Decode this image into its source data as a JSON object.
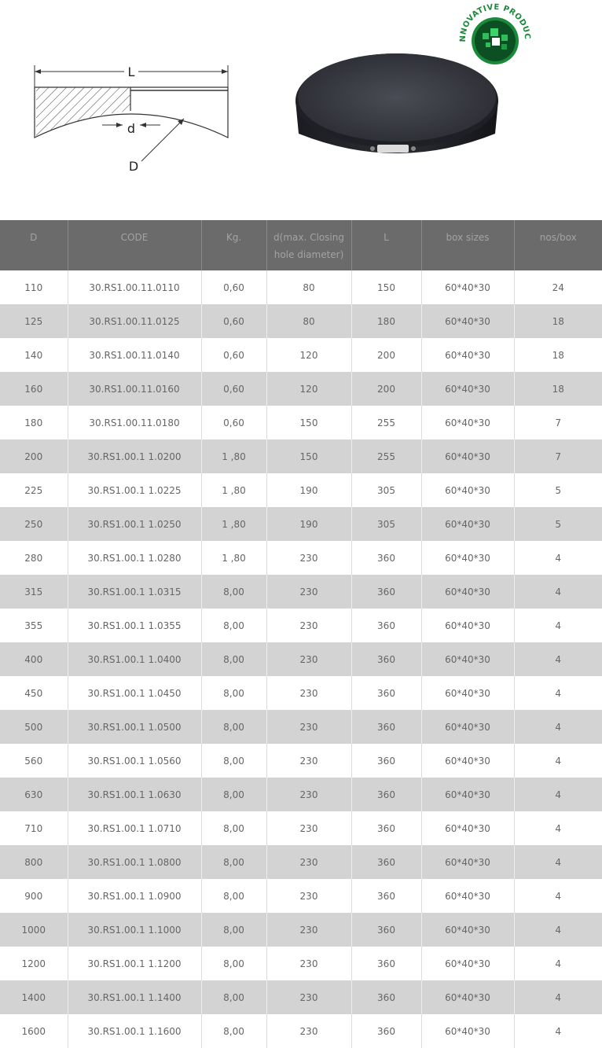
{
  "diagram": {
    "label_L": "L",
    "label_d": "d",
    "label_D": "D"
  },
  "badge": {
    "text": "INNOVATIVE PRODUCT",
    "colors": {
      "green": "#1a8a3a",
      "dark_green": "#0b4f22"
    }
  },
  "table": {
    "headers": [
      "D",
      "CODE",
      "Kg.",
      "d(max. Closing hole diameter)",
      "L",
      "box sizes",
      "nos/box"
    ],
    "rows": [
      [
        "110",
        "30.RS1.00.11.0110",
        "0,60",
        "80",
        "150",
        "60*40*30",
        "24"
      ],
      [
        "125",
        "30.RS1.00.11.0125",
        "0,60",
        "80",
        "180",
        "60*40*30",
        "18"
      ],
      [
        "140",
        "30.RS1.00.11.0140",
        "0,60",
        "120",
        "200",
        "60*40*30",
        "18"
      ],
      [
        "160",
        "30.RS1.00.11.0160",
        "0,60",
        "120",
        "200",
        "60*40*30",
        "18"
      ],
      [
        "180",
        "30.RS1.00.11.0180",
        "0,60",
        "150",
        "255",
        "60*40*30",
        "7"
      ],
      [
        "200",
        "30.RS1.00.1 1.0200",
        "1 ,80",
        "150",
        "255",
        "60*40*30",
        "7"
      ],
      [
        "225",
        "30.RS1.00.1 1.0225",
        "1 ,80",
        "190",
        "305",
        "60*40*30",
        "5"
      ],
      [
        "250",
        "30.RS1.00.1 1.0250",
        "1 ,80",
        "190",
        "305",
        "60*40*30",
        "5"
      ],
      [
        "280",
        "30.RS1.00.1 1.0280",
        "1 ,80",
        "230",
        "360",
        "60*40*30",
        "4"
      ],
      [
        "315",
        "30.RS1.00.1 1.0315",
        "8,00",
        "230",
        "360",
        "60*40*30",
        "4"
      ],
      [
        "355",
        "30.RS1.00.1 1.0355",
        "8,00",
        "230",
        "360",
        "60*40*30",
        "4"
      ],
      [
        "400",
        "30.RS1.00.1 1.0400",
        "8,00",
        "230",
        "360",
        "60*40*30",
        "4"
      ],
      [
        "450",
        "30.RS1.00.1 1.0450",
        "8,00",
        "230",
        "360",
        "60*40*30",
        "4"
      ],
      [
        "500",
        "30.RS1.00.1 1.0500",
        "8,00",
        "230",
        "360",
        "60*40*30",
        "4"
      ],
      [
        "560",
        "30.RS1.00.1 1.0560",
        "8,00",
        "230",
        "360",
        "60*40*30",
        "4"
      ],
      [
        "630",
        "30.RS1.00.1 1.0630",
        "8,00",
        "230",
        "360",
        "60*40*30",
        "4"
      ],
      [
        "710",
        "30.RS1.00.1 1.0710",
        "8,00",
        "230",
        "360",
        "60*40*30",
        "4"
      ],
      [
        "800",
        "30.RS1.00.1 1.0800",
        "8,00",
        "230",
        "360",
        "60*40*30",
        "4"
      ],
      [
        "900",
        "30.RS1.00.1 1.0900",
        "8,00",
        "230",
        "360",
        "60*40*30",
        "4"
      ],
      [
        "1000",
        "30.RS1.00.1 1.1000",
        "8,00",
        "230",
        "360",
        "60*40*30",
        "4"
      ],
      [
        "1200",
        "30.RS1.00.1 1.1200",
        "8,00",
        "230",
        "360",
        "60*40*30",
        "4"
      ],
      [
        "1400",
        "30.RS1.00.1 1.1400",
        "8,00",
        "230",
        "360",
        "60*40*30",
        "4"
      ],
      [
        "1600",
        "30.RS1.00.1 1.1600",
        "8,00",
        "230",
        "360",
        "60*40*30",
        "4"
      ]
    ]
  }
}
